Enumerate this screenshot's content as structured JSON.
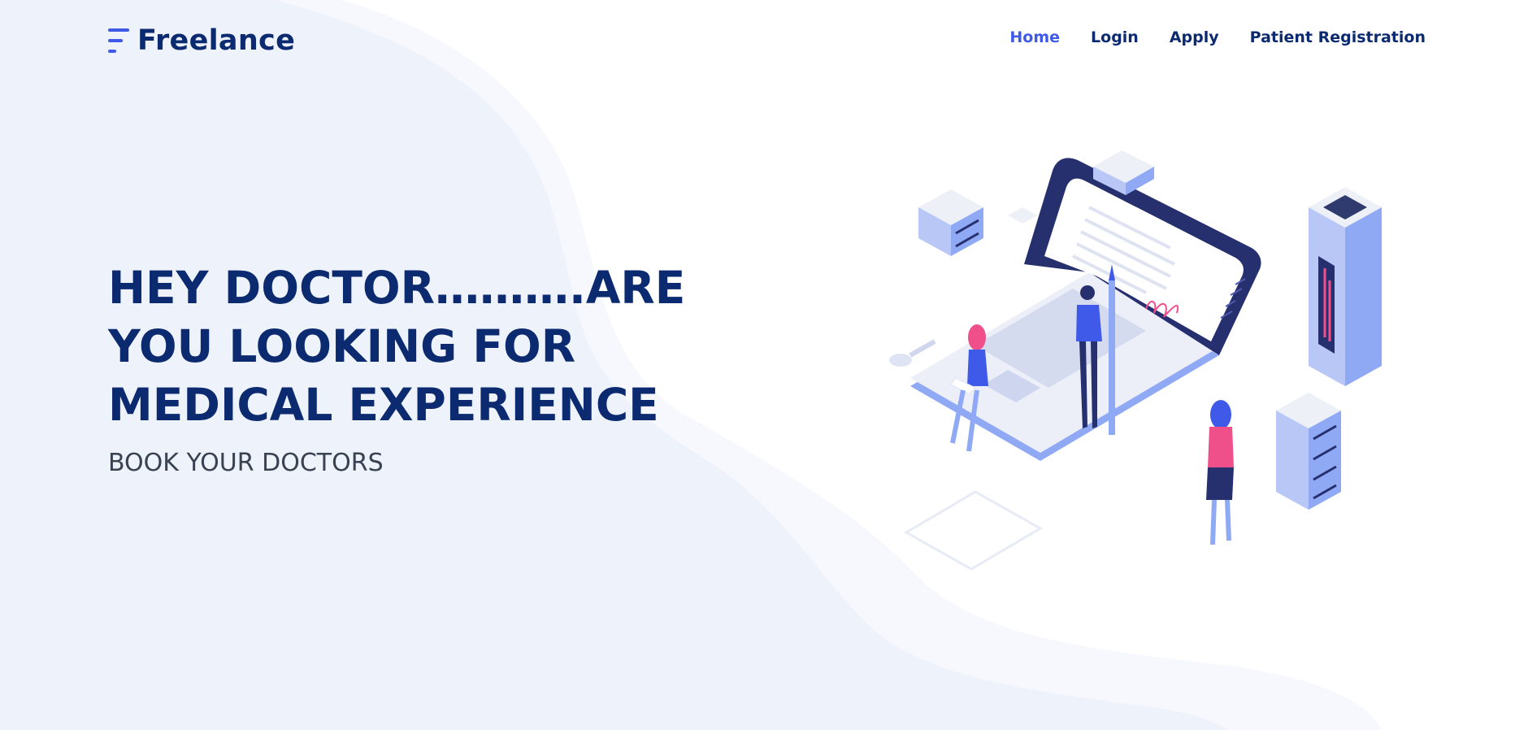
{
  "brand": {
    "name": "Freelance",
    "logo_icon": "stacked-lines-icon"
  },
  "nav": {
    "items": [
      {
        "label": "Home",
        "active": true
      },
      {
        "label": "Login",
        "active": false
      },
      {
        "label": "Apply",
        "active": false
      },
      {
        "label": "Patient Registration",
        "active": false
      }
    ]
  },
  "hero": {
    "title": "HEY DOCTOR……….ARE YOU LOOKING FOR MEDICAL EXPERIENCE",
    "subtitle": "BOOK YOUR DOCTORS",
    "illustration": "isometric-laptop-doctors-illustration"
  },
  "colors": {
    "primary": "#0b2a6f",
    "accent": "#3f5ae8",
    "background_wave": "#eef2fb",
    "pink": "#f0508a"
  }
}
